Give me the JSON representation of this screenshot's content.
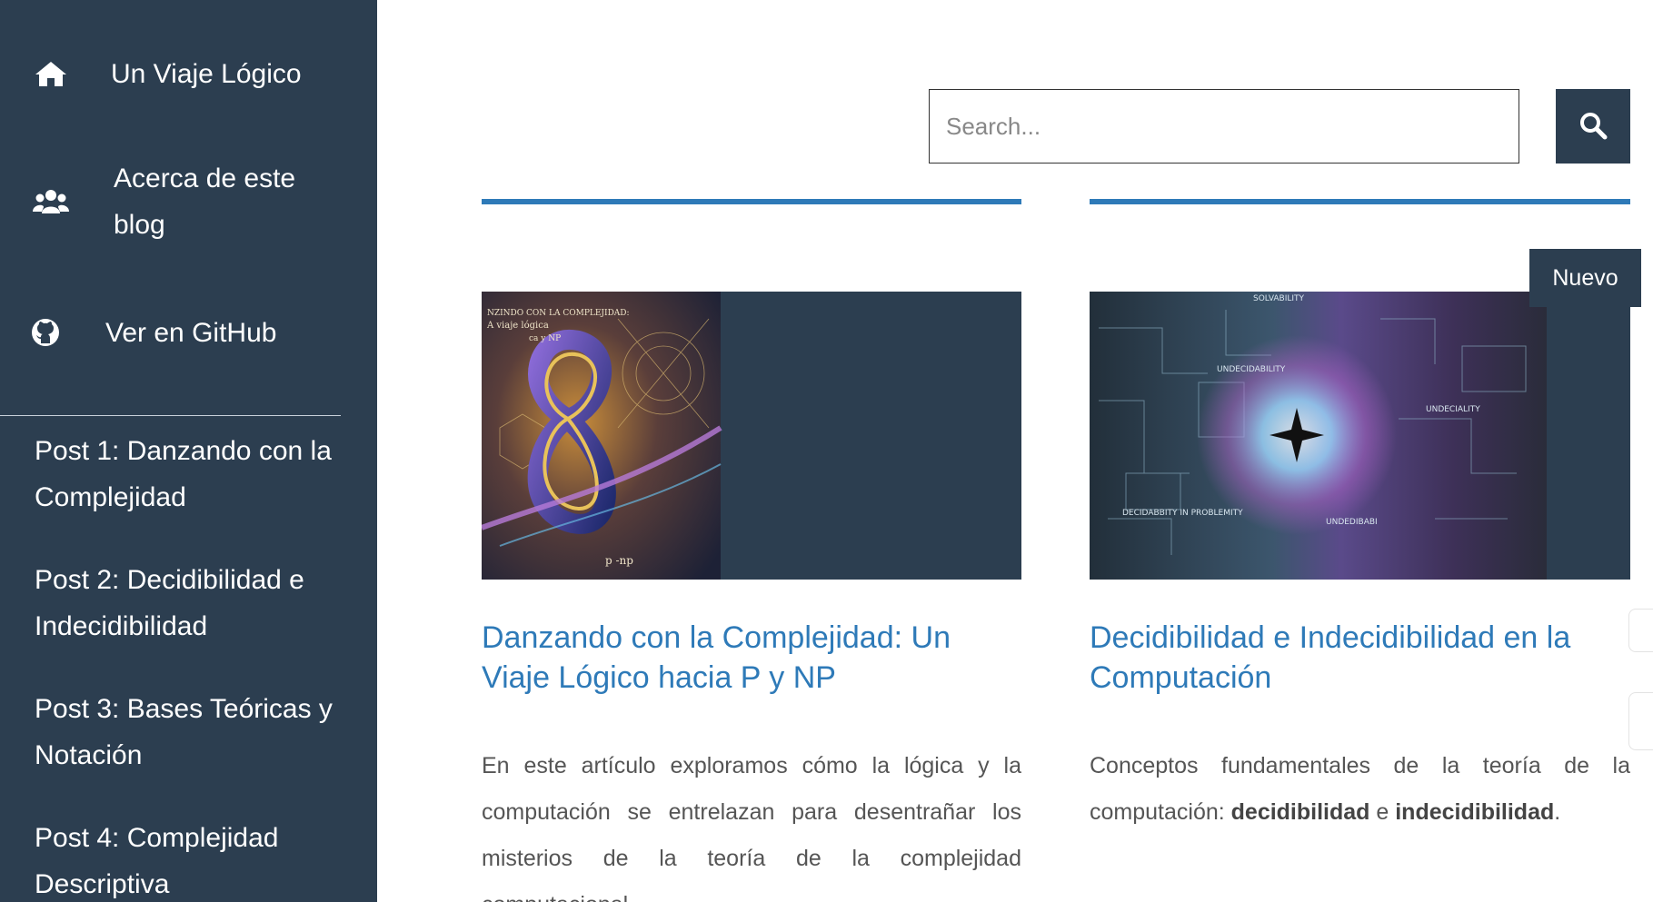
{
  "sidebar": {
    "nav": [
      {
        "label": "Un Viaje Lógico",
        "icon": "home-icon"
      },
      {
        "label": "Acerca de este blog",
        "icon": "users-icon"
      },
      {
        "label": "Ver en GitHub",
        "icon": "github-icon"
      }
    ],
    "posts": [
      {
        "label": "Post 1: Danzando con la Complejidad"
      },
      {
        "label": "Post 2: Decidibilidad e Indecidibilidad"
      },
      {
        "label": "Post 3: Bases Teóricas y Notación"
      },
      {
        "label": "Post 4: Complejidad Descriptiva"
      }
    ]
  },
  "search": {
    "placeholder": "Search...",
    "value": "",
    "button_icon": "search-icon"
  },
  "cards": [
    {
      "title": "Danzando con la Complejidad: Un Viaje Lógico hacia P y NP",
      "excerpt": "En este artículo exploramos cómo la lógica y la computación se entrelazan para desentrañar los misterios de la teoría de la complejidad computacional.",
      "image_text": [
        "NZINDO CON LA COMPLEJIDAD:",
        "A viaje lógica",
        "ca y NP",
        "p -np"
      ]
    },
    {
      "badge": "Nuevo",
      "title": "Decidibilidad e Indecidibilidad en la Computación",
      "excerpt_pre": "Conceptos fundamentales de la teoría de la computación: ",
      "excerpt_bold_1": "decidibilidad",
      "excerpt_mid": " e ",
      "excerpt_bold_2": "indecidibilidad",
      "excerpt_post": ".",
      "image_text": [
        "SOLVABILITY",
        "UNDECIDABILITY",
        "UNDECIALITY",
        "DECIDABBITY IN PROBLEMITY",
        "UNDEDIBABI"
      ]
    }
  ],
  "colors": {
    "sidebar_bg": "#2c3e50",
    "accent": "#2e7ab8",
    "text": "#555555"
  }
}
